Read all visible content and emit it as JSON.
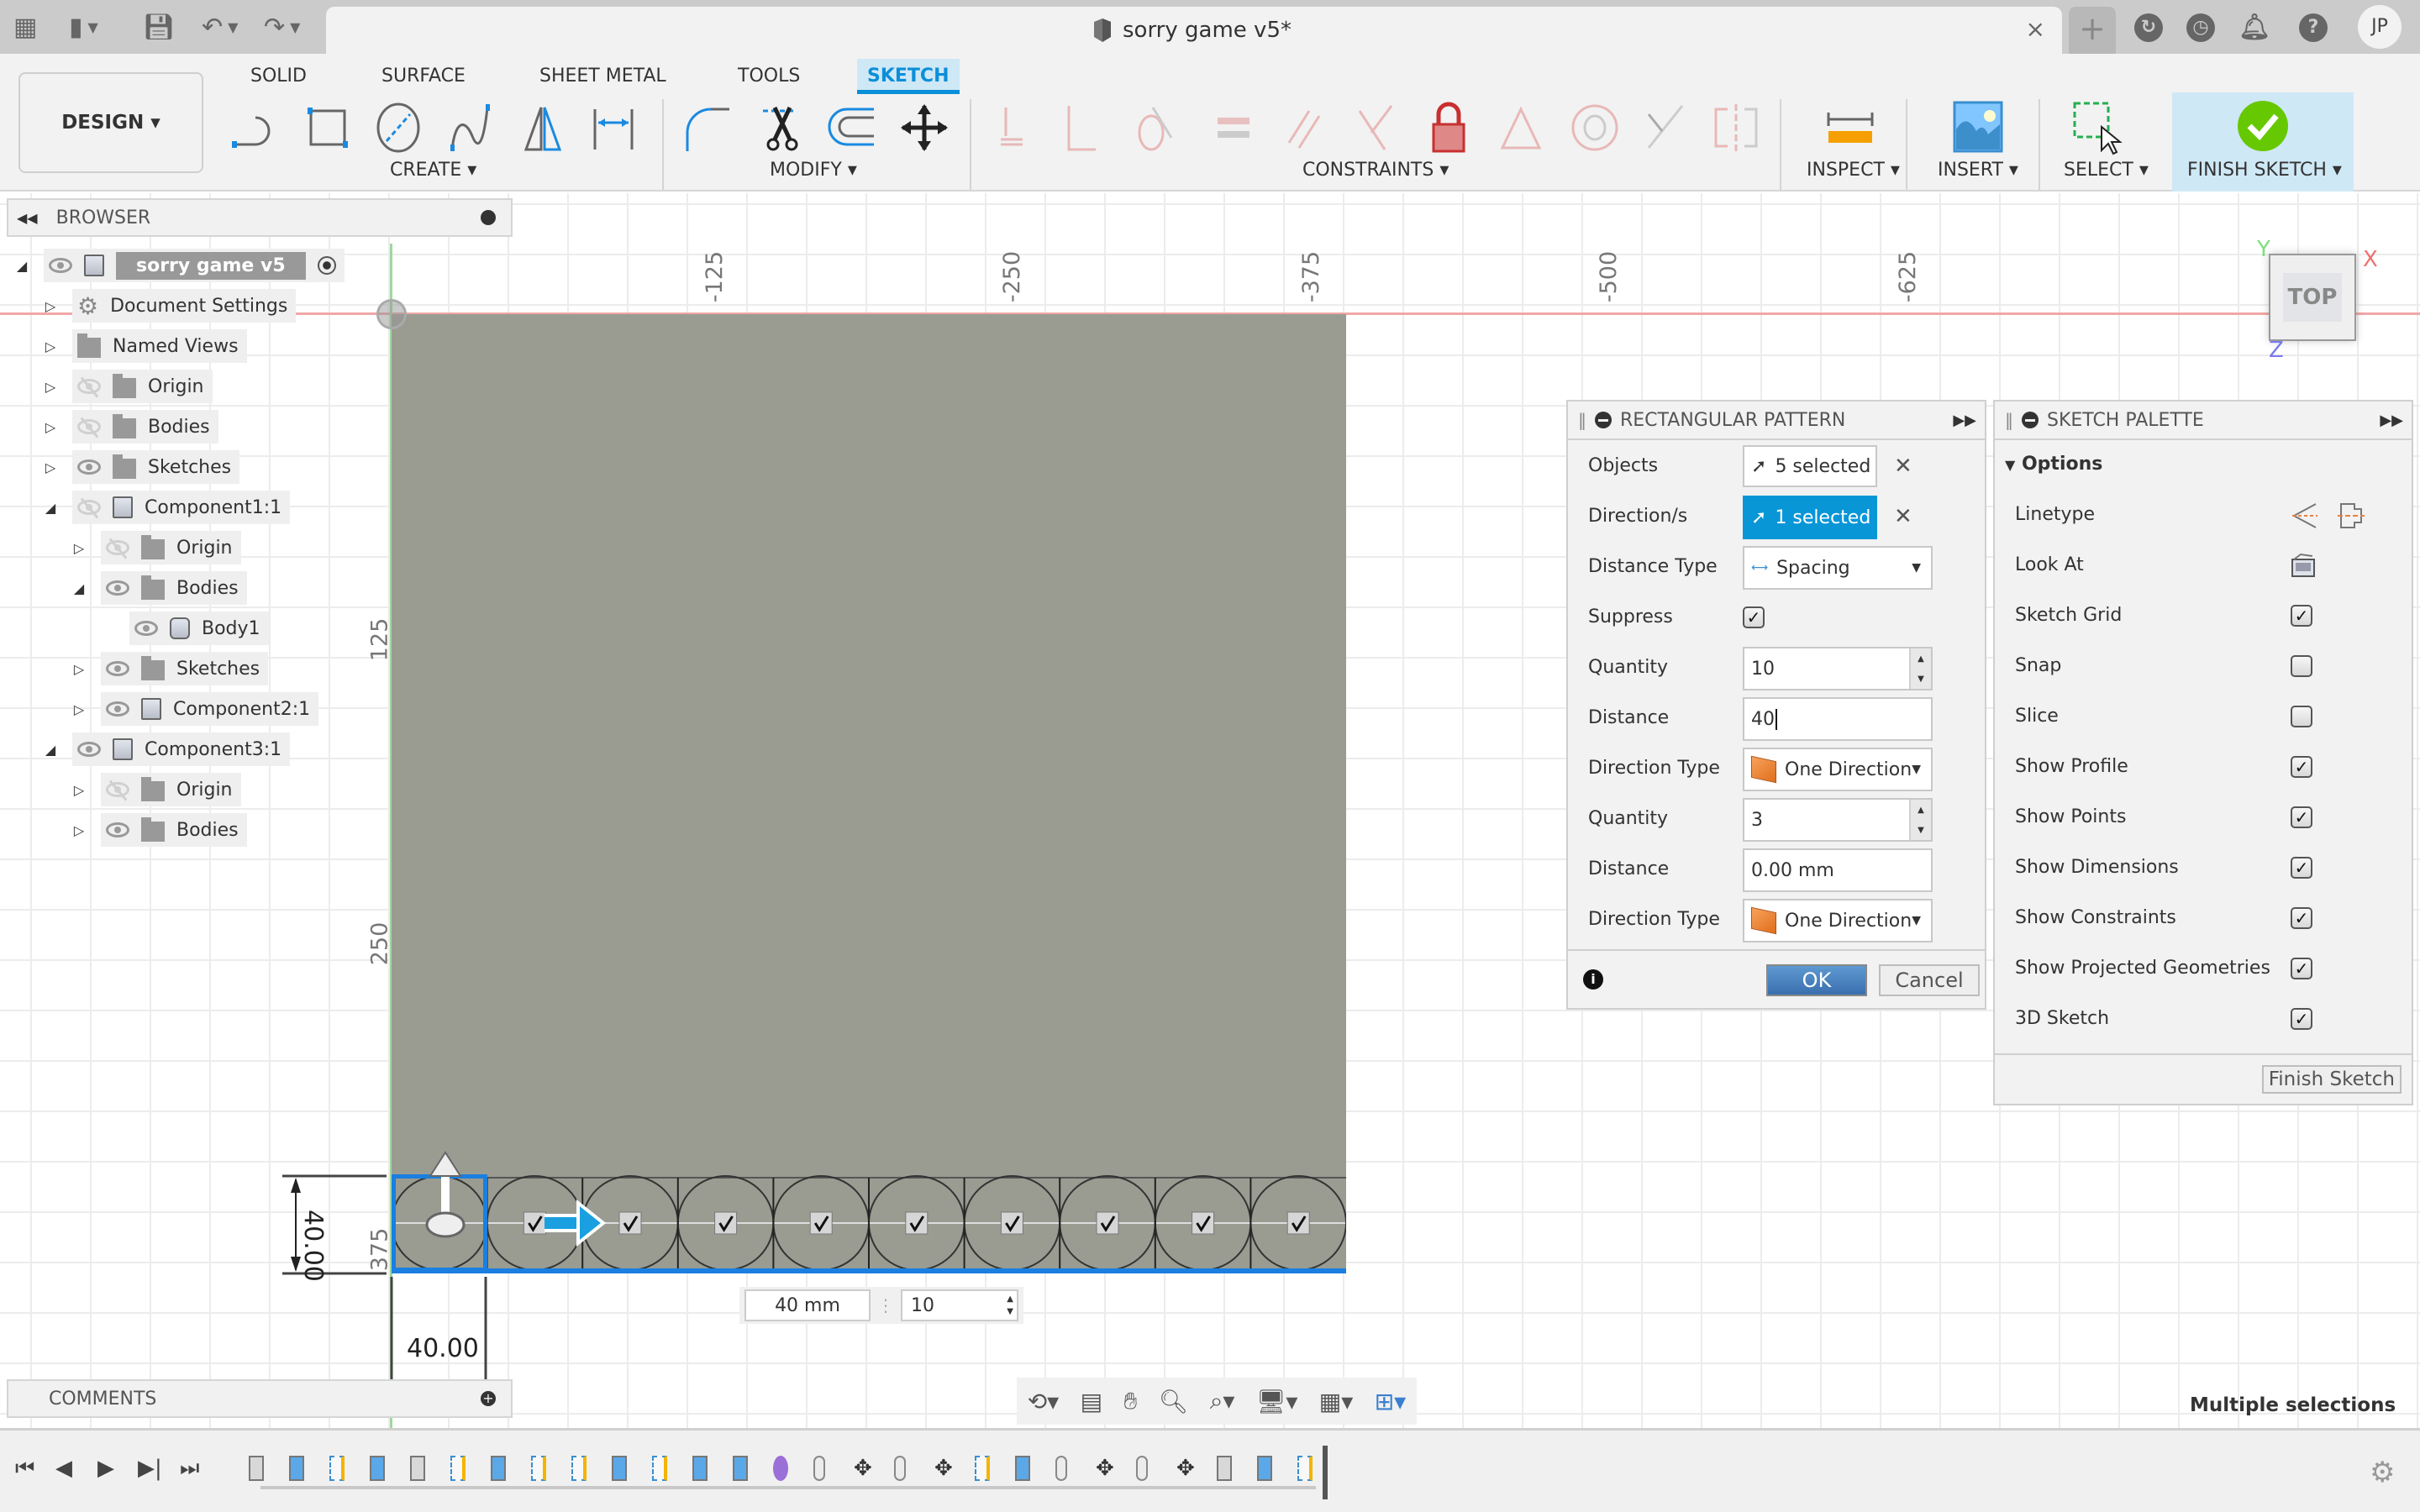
{
  "window": {
    "doc_title": "sorry game v5*",
    "close_glyph": "×",
    "new_tab_glyph": "+",
    "user_initials": "JP",
    "toolbar_icons": [
      "apps-grid-icon",
      "file-icon",
      "save-icon",
      "undo-icon",
      "redo-icon"
    ],
    "right_icons": [
      "extensions-icon",
      "job-status-icon",
      "notifications-icon",
      "help-icon"
    ]
  },
  "ribbon": {
    "workspace_label": "DESIGN ▾",
    "tabs": [
      {
        "label": "SOLID",
        "active": false
      },
      {
        "label": "SURFACE",
        "active": false
      },
      {
        "label": "SHEET METAL",
        "active": false
      },
      {
        "label": "TOOLS",
        "active": false
      },
      {
        "label": "SKETCH",
        "active": true
      }
    ],
    "groups": {
      "create": "CREATE ▾",
      "modify": "MODIFY ▾",
      "constraints": "CONSTRAINTS ▾",
      "inspect": "INSPECT ▾",
      "insert": "INSERT ▾",
      "select": "SELECT ▾",
      "finish": "FINISH SKETCH ▾"
    },
    "create_tools": [
      "line",
      "rectangle",
      "circle",
      "spline",
      "mirror",
      "dimension"
    ],
    "modify_tools": [
      "fillet",
      "trim",
      "offset",
      "move-copy"
    ],
    "constraint_tools": [
      "fix",
      "coincident",
      "tangent",
      "equal",
      "parallel",
      "perpendicular",
      "lock",
      "midpoint",
      "concentric",
      "collinear",
      "symmetry"
    ]
  },
  "browser": {
    "title": "BROWSER",
    "items": [
      {
        "label": "sorry game v5",
        "level": 0,
        "expanded": true,
        "icon": "component",
        "visible": true,
        "root": true
      },
      {
        "label": "Document Settings",
        "level": 1,
        "expanded": false,
        "icon": "gear"
      },
      {
        "label": "Named Views",
        "level": 1,
        "expanded": false,
        "icon": "folder"
      },
      {
        "label": "Origin",
        "level": 1,
        "expanded": false,
        "icon": "folder",
        "visible": false
      },
      {
        "label": "Bodies",
        "level": 1,
        "expanded": false,
        "icon": "folder",
        "visible": false
      },
      {
        "label": "Sketches",
        "level": 1,
        "expanded": false,
        "icon": "folder",
        "visible": true
      },
      {
        "label": "Component1:1",
        "level": 1,
        "expanded": true,
        "icon": "component",
        "visible": false
      },
      {
        "label": "Origin",
        "level": 2,
        "expanded": false,
        "icon": "folder",
        "visible": false
      },
      {
        "label": "Bodies",
        "level": 2,
        "expanded": true,
        "icon": "folder",
        "visible": true
      },
      {
        "label": "Body1",
        "level": 3,
        "icon": "body",
        "visible": true
      },
      {
        "label": "Sketches",
        "level": 2,
        "expanded": false,
        "icon": "folder",
        "visible": true
      },
      {
        "label": "Component2:1",
        "level": 2,
        "expanded": false,
        "icon": "component",
        "visible": true
      },
      {
        "label": "Component3:1",
        "level": 1,
        "expanded": true,
        "icon": "component",
        "visible": true
      },
      {
        "label": "Origin",
        "level": 2,
        "expanded": false,
        "icon": "folder",
        "visible": false
      },
      {
        "label": "Bodies",
        "level": 2,
        "expanded": false,
        "icon": "folder",
        "visible": true
      }
    ]
  },
  "comments": {
    "title": "COMMENTS"
  },
  "canvas": {
    "ruler_top": [
      "-125",
      "-250",
      "-375",
      "-500",
      "-625"
    ],
    "ruler_left": [
      "125",
      "250",
      "375"
    ],
    "viewcube": {
      "face": "TOP",
      "x": "X",
      "y": "Y",
      "z": "Z"
    },
    "dimensions": {
      "vertical": "40.00",
      "horizontal": "40.00"
    },
    "pattern_inline": {
      "distance": "40 mm",
      "quantity": "10"
    },
    "pattern_instances": 10
  },
  "rect_pattern": {
    "title": "RECTANGULAR PATTERN",
    "rows": {
      "objects": {
        "label": "Objects",
        "value": "5 selected"
      },
      "directions": {
        "label": "Direction/s",
        "value": "1 selected"
      },
      "distance_type": {
        "label": "Distance Type",
        "value": "Spacing"
      },
      "suppress": {
        "label": "Suppress",
        "checked": true
      },
      "quantity1": {
        "label": "Quantity",
        "value": "10"
      },
      "distance1": {
        "label": "Distance",
        "value": "40"
      },
      "direction_type1": {
        "label": "Direction Type",
        "value": "One Direction"
      },
      "quantity2": {
        "label": "Quantity",
        "value": "3"
      },
      "distance2": {
        "label": "Distance",
        "value": "0.00 mm"
      },
      "direction_type2": {
        "label": "Direction Type",
        "value": "One Direction"
      }
    },
    "ok": "OK",
    "cancel": "Cancel"
  },
  "sketch_palette": {
    "title": "SKETCH PALETTE",
    "section": "Options",
    "linetype_label": "Linetype",
    "look_at_label": "Look At",
    "options": [
      {
        "label": "Sketch Grid",
        "checked": true
      },
      {
        "label": "Snap",
        "checked": false
      },
      {
        "label": "Slice",
        "checked": false
      },
      {
        "label": "Show Profile",
        "checked": true
      },
      {
        "label": "Show Points",
        "checked": true
      },
      {
        "label": "Show Dimensions",
        "checked": true
      },
      {
        "label": "Show Constraints",
        "checked": true
      },
      {
        "label": "Show Projected Geometries",
        "checked": true
      },
      {
        "label": "3D Sketch",
        "checked": true
      }
    ],
    "finish_button": "Finish Sketch"
  },
  "status": {
    "selection": "Multiple selections"
  },
  "timeline": {
    "controls": [
      "⏮",
      "◀",
      "▶",
      "▶|",
      "⏭"
    ],
    "items": [
      "box",
      "extrude",
      "sketch",
      "extrude",
      "box",
      "sketch",
      "extrude",
      "sketch",
      "sketch",
      "extrude",
      "sketch",
      "extrude",
      "extrude",
      "joint",
      "rigid-group",
      "move",
      "rigid-group",
      "move",
      "sketch",
      "extrude",
      "rigid-group",
      "move",
      "rigid-group",
      "move",
      "box",
      "extrude",
      "sketch"
    ]
  },
  "colors": {
    "accent": "#0b8fd8",
    "selection": "#1a7fe0",
    "body_fill": "#9a9c92",
    "finish_green": "#66c800",
    "x_axis": "#f1a7a7",
    "y_axis": "#9fd79f"
  }
}
